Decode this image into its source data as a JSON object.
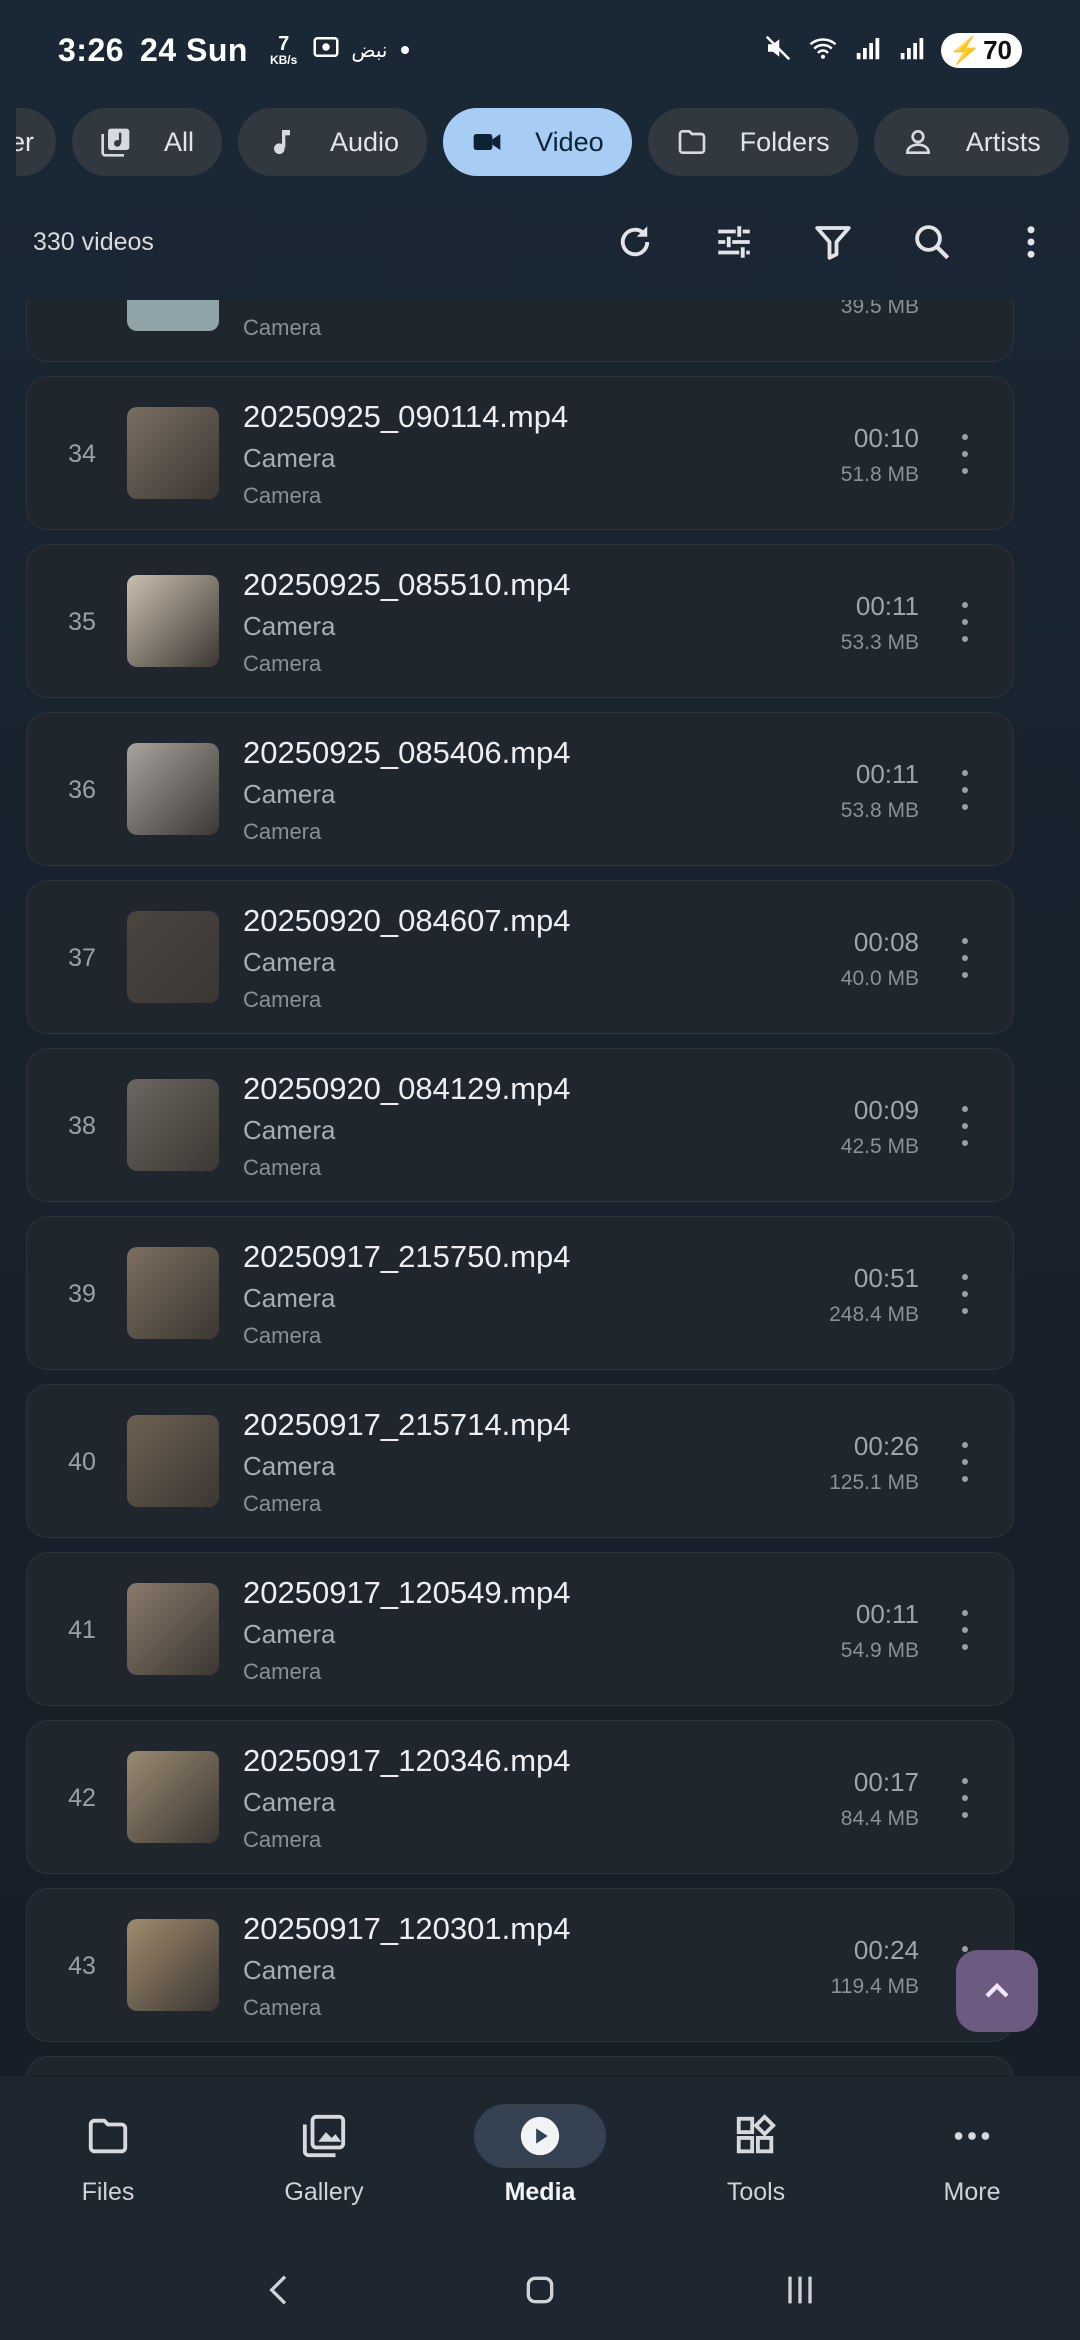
{
  "status": {
    "time": "3:26",
    "date": "24 Sun",
    "net_speed": "7",
    "net_unit": "KB/s",
    "arabic": "نبض",
    "battery": "70"
  },
  "chips": [
    {
      "label": "er",
      "partial": true
    },
    {
      "label": "All",
      "icon": "library-music-icon"
    },
    {
      "label": "Audio",
      "icon": "music-note-icon"
    },
    {
      "label": "Video",
      "icon": "videocam-icon",
      "active": true
    },
    {
      "label": "Folders",
      "icon": "folder-icon"
    },
    {
      "label": "Artists",
      "icon": "person-icon"
    }
  ],
  "toolbar": {
    "count": "330 videos"
  },
  "top_partial": {
    "sub": "Camera",
    "size": "39.5 MB"
  },
  "videos": [
    {
      "index": "34",
      "name": "20250925_090114.mp4",
      "album": "Camera",
      "folder": "Camera",
      "duration": "00:10",
      "size": "51.8 MB"
    },
    {
      "index": "35",
      "name": "20250925_085510.mp4",
      "album": "Camera",
      "folder": "Camera",
      "duration": "00:11",
      "size": "53.3 MB"
    },
    {
      "index": "36",
      "name": "20250925_085406.mp4",
      "album": "Camera",
      "folder": "Camera",
      "duration": "00:11",
      "size": "53.8 MB"
    },
    {
      "index": "37",
      "name": "20250920_084607.mp4",
      "album": "Camera",
      "folder": "Camera",
      "duration": "00:08",
      "size": "40.0 MB"
    },
    {
      "index": "38",
      "name": "20250920_084129.mp4",
      "album": "Camera",
      "folder": "Camera",
      "duration": "00:09",
      "size": "42.5 MB"
    },
    {
      "index": "39",
      "name": "20250917_215750.mp4",
      "album": "Camera",
      "folder": "Camera",
      "duration": "00:51",
      "size": "248.4 MB"
    },
    {
      "index": "40",
      "name": "20250917_215714.mp4",
      "album": "Camera",
      "folder": "Camera",
      "duration": "00:26",
      "size": "125.1 MB"
    },
    {
      "index": "41",
      "name": "20250917_120549.mp4",
      "album": "Camera",
      "folder": "Camera",
      "duration": "00:11",
      "size": "54.9 MB"
    },
    {
      "index": "42",
      "name": "20250917_120346.mp4",
      "album": "Camera",
      "folder": "Camera",
      "duration": "00:17",
      "size": "84.4 MB"
    },
    {
      "index": "43",
      "name": "20250917_120301.mp4",
      "album": "Camera",
      "folder": "Camera",
      "duration": "00:24",
      "size": "119.4 MB"
    }
  ],
  "thumb_colors": [
    "#7a6e62",
    "#cbbfae",
    "#a8a39d",
    "#4a4541",
    "#6c6760",
    "#7d6f5f",
    "#6e6152",
    "#8a7b6a",
    "#9a8a72",
    "#a08b6e"
  ],
  "nav": [
    {
      "label": "Files",
      "icon": "folder-icon"
    },
    {
      "label": "Gallery",
      "icon": "gallery-icon"
    },
    {
      "label": "Media",
      "icon": "play-circle-icon",
      "active": true
    },
    {
      "label": "Tools",
      "icon": "widgets-icon"
    },
    {
      "label": "More",
      "icon": "more-horiz-icon"
    }
  ],
  "colors": {
    "accent_chip": "#a8cdf5",
    "fab": "#6d5a80",
    "card": "#1f262e"
  }
}
